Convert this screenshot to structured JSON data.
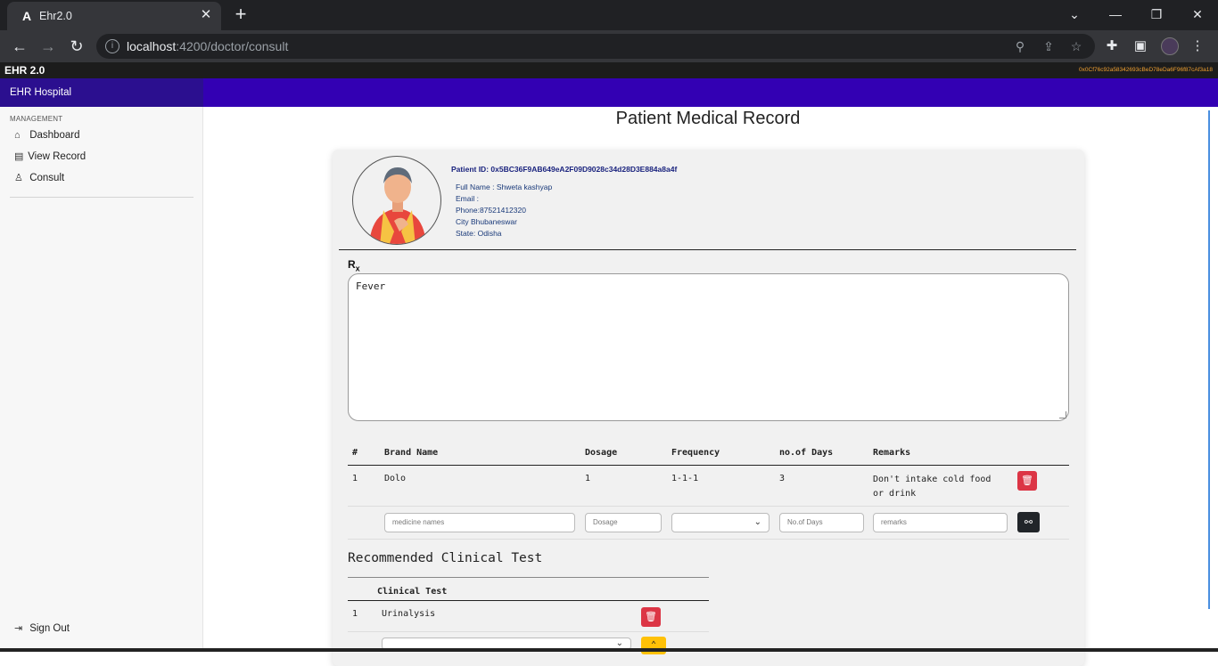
{
  "browser": {
    "tab_title": "Ehr2.0",
    "tab_favicon": "angular-icon",
    "url_host": "localhost",
    "url_path": ":4200/doctor/consult"
  },
  "app": {
    "brand": "EHR 2.0",
    "wallet_address": "0x0Cf76c92a58342693cBeD78eDa6F96f87cAf3a18",
    "hospital_name": "EHR Hospital",
    "accent_color": "#3300b3"
  },
  "sidebar": {
    "heading": "MANAGEMENT",
    "items": [
      {
        "label": "Dashboard",
        "icon": "home-icon"
      },
      {
        "label": "View Record",
        "icon": "clipboard-icon"
      },
      {
        "label": "Consult",
        "icon": "consult-icon"
      }
    ],
    "sign_out": "Sign Out"
  },
  "page": {
    "title": "Patient Medical Record"
  },
  "patient": {
    "id_label": "Patient ID:",
    "id_value": "0x5BC36F9AB649eA2F09D9028c34d28D3E884a8a4f",
    "full_name_label": "Full Name :",
    "full_name": "Shweta kashyap",
    "email_label": "Email :",
    "email": "",
    "phone_label": "Phone:",
    "phone": "87521412320",
    "city_label": "City",
    "city": "Bhubaneswar",
    "state_label": "State:",
    "state": "Odisha"
  },
  "prescription": {
    "rx_symbol": "R",
    "rx_sub": "x",
    "notes": "Fever"
  },
  "medicine_table": {
    "headers": [
      "#",
      "Brand Name",
      "Dosage",
      "Frequency",
      "no.of Days",
      "Remarks"
    ],
    "rows": [
      {
        "num": "1",
        "brand": "Dolo",
        "dosage": "1",
        "frequency": "1-1-1",
        "days": "3",
        "remarks": "Don't intake cold food or drink"
      }
    ],
    "form": {
      "brand_placeholder": "medicine names",
      "dosage_placeholder": "Dosage",
      "frequency_value": "",
      "days_placeholder": "No.of Days",
      "remarks_placeholder": "remarks"
    }
  },
  "clinical_test": {
    "title": "Recommended Clinical Test",
    "header": "Clinical Test",
    "rows": [
      {
        "num": "1",
        "name": "Urinalysis"
      }
    ]
  }
}
